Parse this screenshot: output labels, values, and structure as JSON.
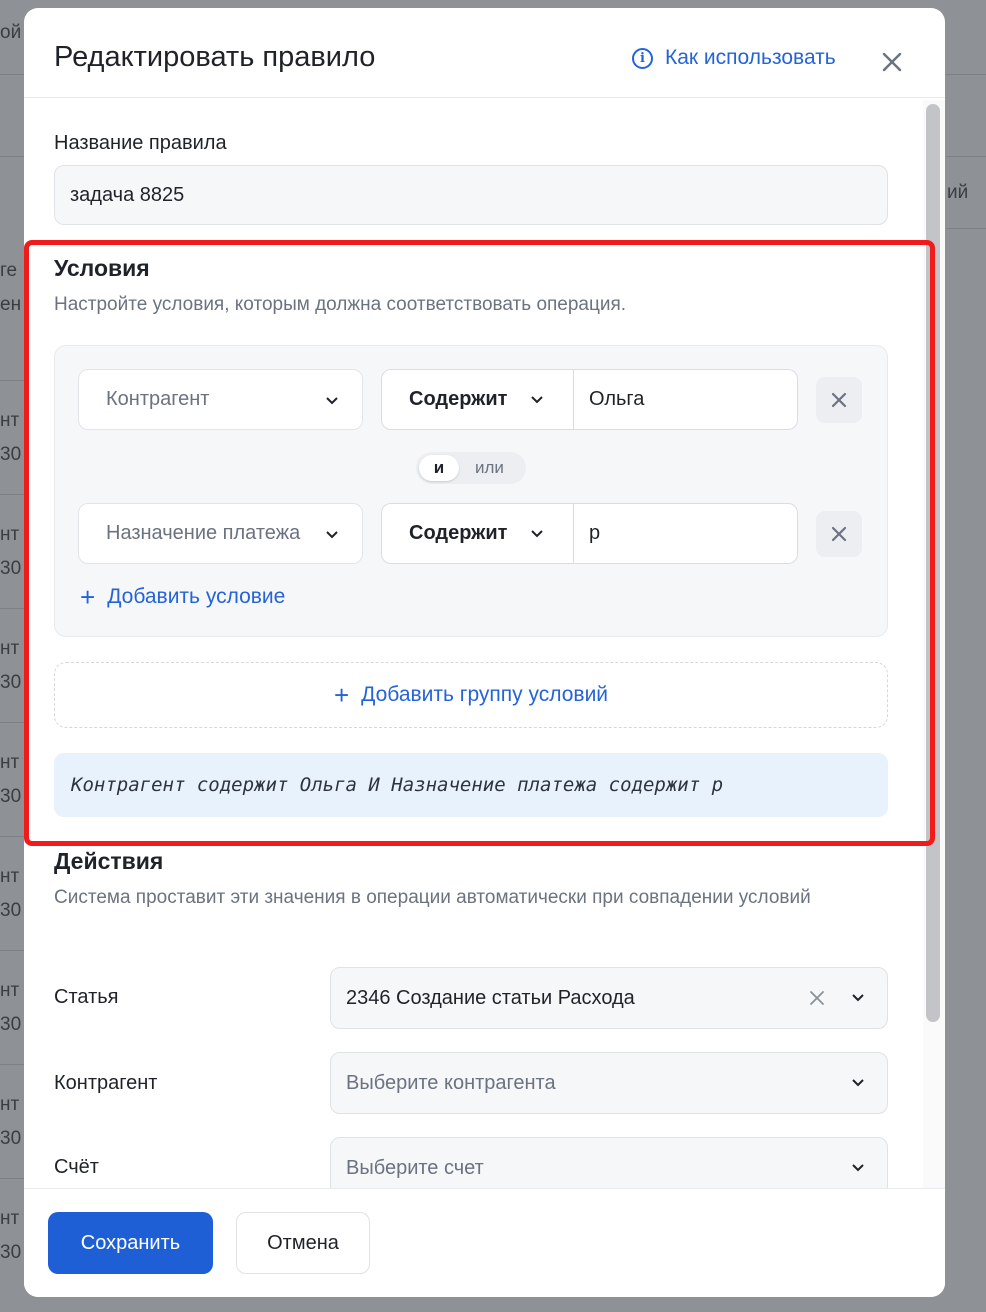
{
  "background": {
    "fragments": [
      "ой",
      "ий",
      "ге",
      "ен",
      "нт",
      "30",
      "нт",
      "30",
      "нт",
      "30",
      "нт",
      "30",
      "нт",
      "30",
      "нт",
      "30",
      "нт",
      "30",
      "нт",
      "30"
    ]
  },
  "modal": {
    "title": "Редактировать правило",
    "help_link": "Как использовать",
    "rule_name_label": "Название правила",
    "rule_name_value": "задача 8825",
    "conditions": {
      "title": "Условия",
      "subtitle": "Настройте условия, которым должна соответствовать операция.",
      "rows": [
        {
          "field": "Контрагент",
          "operator": "Содержит",
          "value": "Ольга"
        },
        {
          "field": "Назначение платежа",
          "operator": "Содержит",
          "value": "р"
        }
      ],
      "logic": {
        "and": "и",
        "or": "или"
      },
      "add_condition": "Добавить условие",
      "add_group": "Добавить группу условий",
      "summary": "Контрагент содержит Ольга И Назначение платежа содержит р"
    },
    "actions": {
      "title": "Действия",
      "subtitle": "Система проставит эти значения в операции автоматически при совпадении условий",
      "rows": [
        {
          "label": "Статья",
          "value": "2346 Создание статьи Расхода",
          "placeholder": ""
        },
        {
          "label": "Контрагент",
          "value": "",
          "placeholder": "Выберите контрагента"
        },
        {
          "label": "Счёт",
          "value": "",
          "placeholder": "Выберите счет"
        }
      ]
    },
    "footer": {
      "save": "Сохранить",
      "cancel": "Отмена"
    }
  },
  "colors": {
    "accent": "#2563d8",
    "primary_button": "#1f5fd6",
    "highlight": "#f21b1b"
  }
}
